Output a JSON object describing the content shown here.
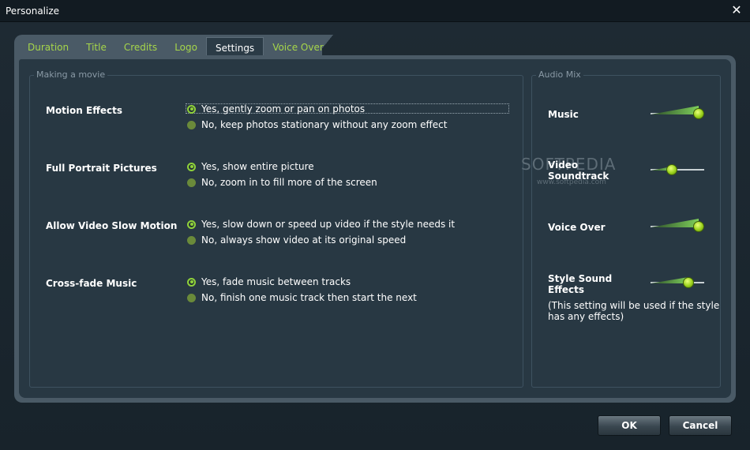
{
  "window": {
    "title": "Personalize"
  },
  "tabs": [
    "Duration",
    "Title",
    "Credits",
    "Logo",
    "Settings",
    "Voice Over"
  ],
  "active_tab": "Settings",
  "making": {
    "legend": "Making a movie",
    "rows": [
      {
        "label": "Motion Effects",
        "options": [
          "Yes, gently zoom or pan on photos",
          "No, keep photos stationary without any zoom effect"
        ],
        "selected": 0
      },
      {
        "label": "Full Portrait Pictures",
        "options": [
          "Yes, show entire picture",
          "No, zoom in to fill more of the screen"
        ],
        "selected": 0
      },
      {
        "label": "Allow Video Slow Motion",
        "options": [
          "Yes, slow down or speed up video if the style needs it",
          "No, always show video at its original speed"
        ],
        "selected": 0
      },
      {
        "label": "Cross-fade Music",
        "options": [
          "Yes, fade music between tracks",
          "No, finish one music track then start the next"
        ],
        "selected": 0
      }
    ]
  },
  "audio": {
    "legend": "Audio Mix",
    "music": {
      "label": "Music",
      "level": 0.9
    },
    "video": {
      "label_1": "Video",
      "label_2": "Soundtrack",
      "level": 0.4
    },
    "voice": {
      "label": "Voice Over",
      "level": 0.9
    },
    "style": {
      "label_1": "Style Sound",
      "label_2": "Effects",
      "level": 0.7,
      "note_1": "(This setting will be used if the style",
      "note_2": "has any effects)"
    }
  },
  "watermark": {
    "main": "SOFTPEDIA",
    "sub": "www.softpedia.com"
  },
  "buttons": {
    "ok": "OK",
    "cancel": "Cancel"
  },
  "colors": {
    "accent": "#a6d64a",
    "panel": "#283843"
  }
}
